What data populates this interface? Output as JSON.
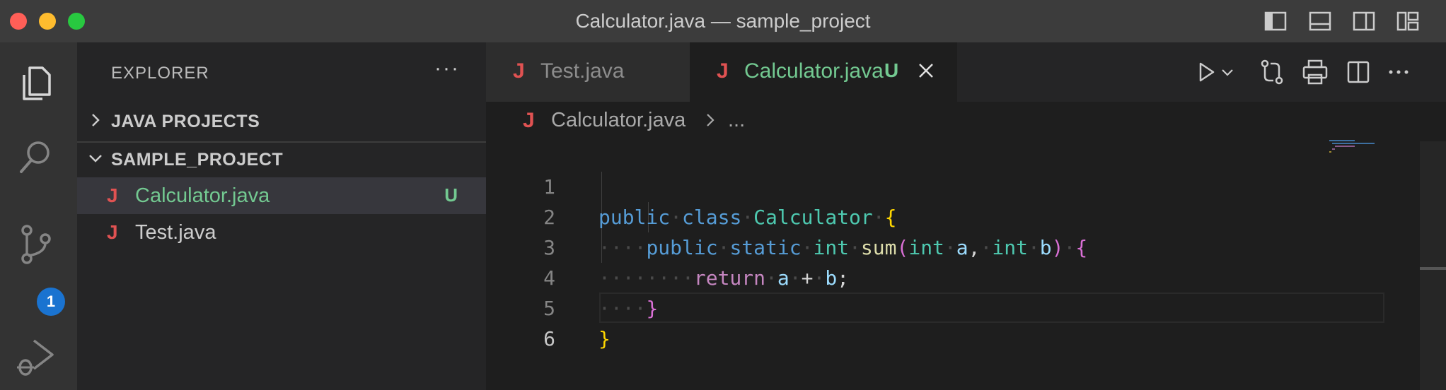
{
  "window": {
    "title": "Calculator.java — sample_project"
  },
  "activity_bar": {
    "icons": [
      "explorer-icon",
      "search-icon",
      "source-control-icon",
      "run-debug-icon"
    ],
    "source_control_badge": "1"
  },
  "sidebar": {
    "title": "EXPLORER",
    "more": "···",
    "sections": [
      {
        "label": "JAVA PROJECTS",
        "expanded": false
      },
      {
        "label": "SAMPLE_PROJECT",
        "expanded": true
      }
    ],
    "files": [
      {
        "icon": "J",
        "name": "Calculator.java",
        "status": "U",
        "selected": true
      },
      {
        "icon": "J",
        "name": "Test.java",
        "status": "",
        "selected": false
      }
    ]
  },
  "tabs": [
    {
      "icon": "J",
      "label": "Test.java",
      "active": false
    },
    {
      "icon": "J",
      "label": "Calculator.java",
      "status": "U",
      "active": true
    }
  ],
  "breadcrumb": {
    "icon": "J",
    "file": "Calculator.java",
    "more": "..."
  },
  "editor": {
    "line_numbers": [
      "1",
      "2",
      "3",
      "4",
      "5",
      "6"
    ],
    "current_line": "6",
    "lines": [
      "public class Calculator {",
      "    public static int sum(int a, int b) {",
      "        return a + b;",
      "    }",
      "}",
      ""
    ]
  },
  "colors": {
    "titlebar": "#3c3c3c",
    "activity_bar": "#333333",
    "sidebar": "#252526",
    "editor": "#1e1e1e",
    "untracked": "#73c991",
    "java_icon": "#e05252",
    "badge": "#1a73d0"
  }
}
